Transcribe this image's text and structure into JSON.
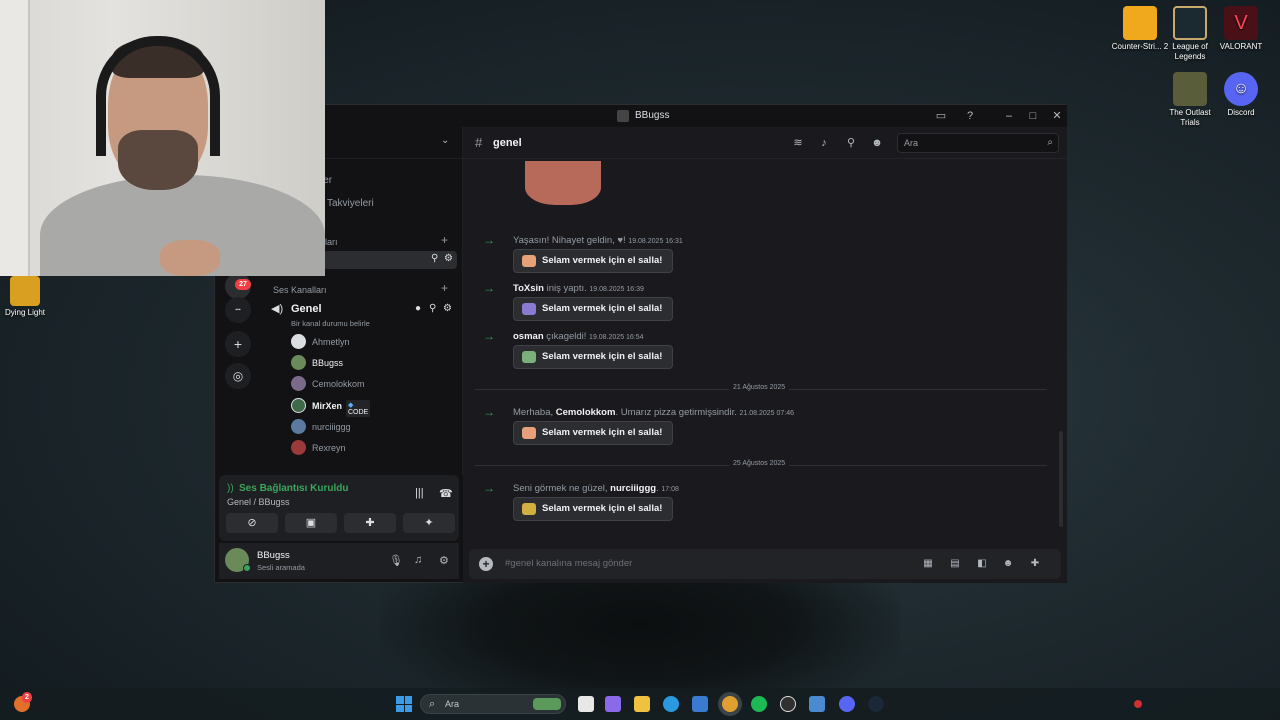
{
  "desktop": {
    "icons": [
      {
        "label": "Counter-Stri... 2",
        "color": "#f0a81c"
      },
      {
        "label": "League of Legends",
        "color": "#c8aa6e"
      },
      {
        "label": "VALORANT",
        "color": "#fd4556"
      },
      {
        "label": "The Outlast Trials",
        "color": "#5a5d3a"
      },
      {
        "label": "Discord",
        "color": "#5865f2"
      },
      {
        "label": "Dying Light",
        "color": "#d9a020"
      }
    ]
  },
  "discord": {
    "window_title": "BBugss",
    "sidebar": {
      "guild_badge": "27",
      "guild_name_partial": "ler",
      "boosts_label": "Takviyeleri",
      "text_category_partial": "ları",
      "voice_category": "Ses Kanalları",
      "voice_channel": {
        "name": "Genel",
        "status_prompt": "Bir kanal durumu belirle"
      },
      "members": [
        {
          "name": "Ahmetlyn",
          "color": "#b5bac1",
          "highlight": false
        },
        {
          "name": "BBugss",
          "color": "#6a8a5a",
          "highlight": true
        },
        {
          "name": "Cemolokkom",
          "color": "#7b6a8a",
          "highlight": false
        },
        {
          "name": "MirXen",
          "color": "#3f6a4a",
          "highlight": true,
          "tag": "CODE"
        },
        {
          "name": "nurciiiggg",
          "color": "#5a7aa0",
          "highlight": false
        },
        {
          "name": "Rexreyn",
          "color": "#9a3a3a",
          "highlight": false
        }
      ]
    },
    "voice_panel": {
      "status": "Ses Bağlantısı Kuruldu",
      "location": "Genel / BBugss"
    },
    "user": {
      "name": "BBugss",
      "status": "Sesli aramada"
    },
    "channel": {
      "name": "genel",
      "search_placeholder": "Ara",
      "composer_placeholder": "#genel kanalına mesaj gönder"
    },
    "messages": [
      {
        "prefix": "",
        "user": "",
        "text": "Yaşasın! Nihayet geldin, ♥!",
        "time": "19.08.2025 16:31",
        "wave": "Selam vermek için el salla!",
        "sticker_color": "#e8a07a"
      },
      {
        "prefix": "",
        "user": "ToXsin",
        "text": "iniş yaptı.",
        "time": "19.08.2025 16:39",
        "wave": "Selam vermek için el salla!",
        "sticker_color": "#8a7ad0"
      },
      {
        "prefix": "",
        "user": "osman",
        "text": "çıkageldi!",
        "time": "19.08.2025 16:54",
        "wave": "Selam vermek için el salla!",
        "sticker_color": "#7ab07a"
      },
      {
        "prefix": "Merhaba,",
        "user": "Cemolokkom",
        "text": ". Umarız pizza getirmişsindir.",
        "time": "21.08.2025 07:46",
        "wave": "Selam vermek için el salla!",
        "sticker_color": "#e8a07a"
      },
      {
        "prefix": "Seni görmek ne güzel,",
        "user": "nurciiiggg",
        "text": ".",
        "time": "17:08",
        "wave": "Selam vermek için el salla!",
        "sticker_color": "#d0b040"
      }
    ],
    "dividers": [
      "21 Ağustos 2025",
      "25 Ağustos 2025"
    ]
  },
  "taskbar": {
    "search_placeholder": "Ara",
    "notification_badge": "2"
  }
}
